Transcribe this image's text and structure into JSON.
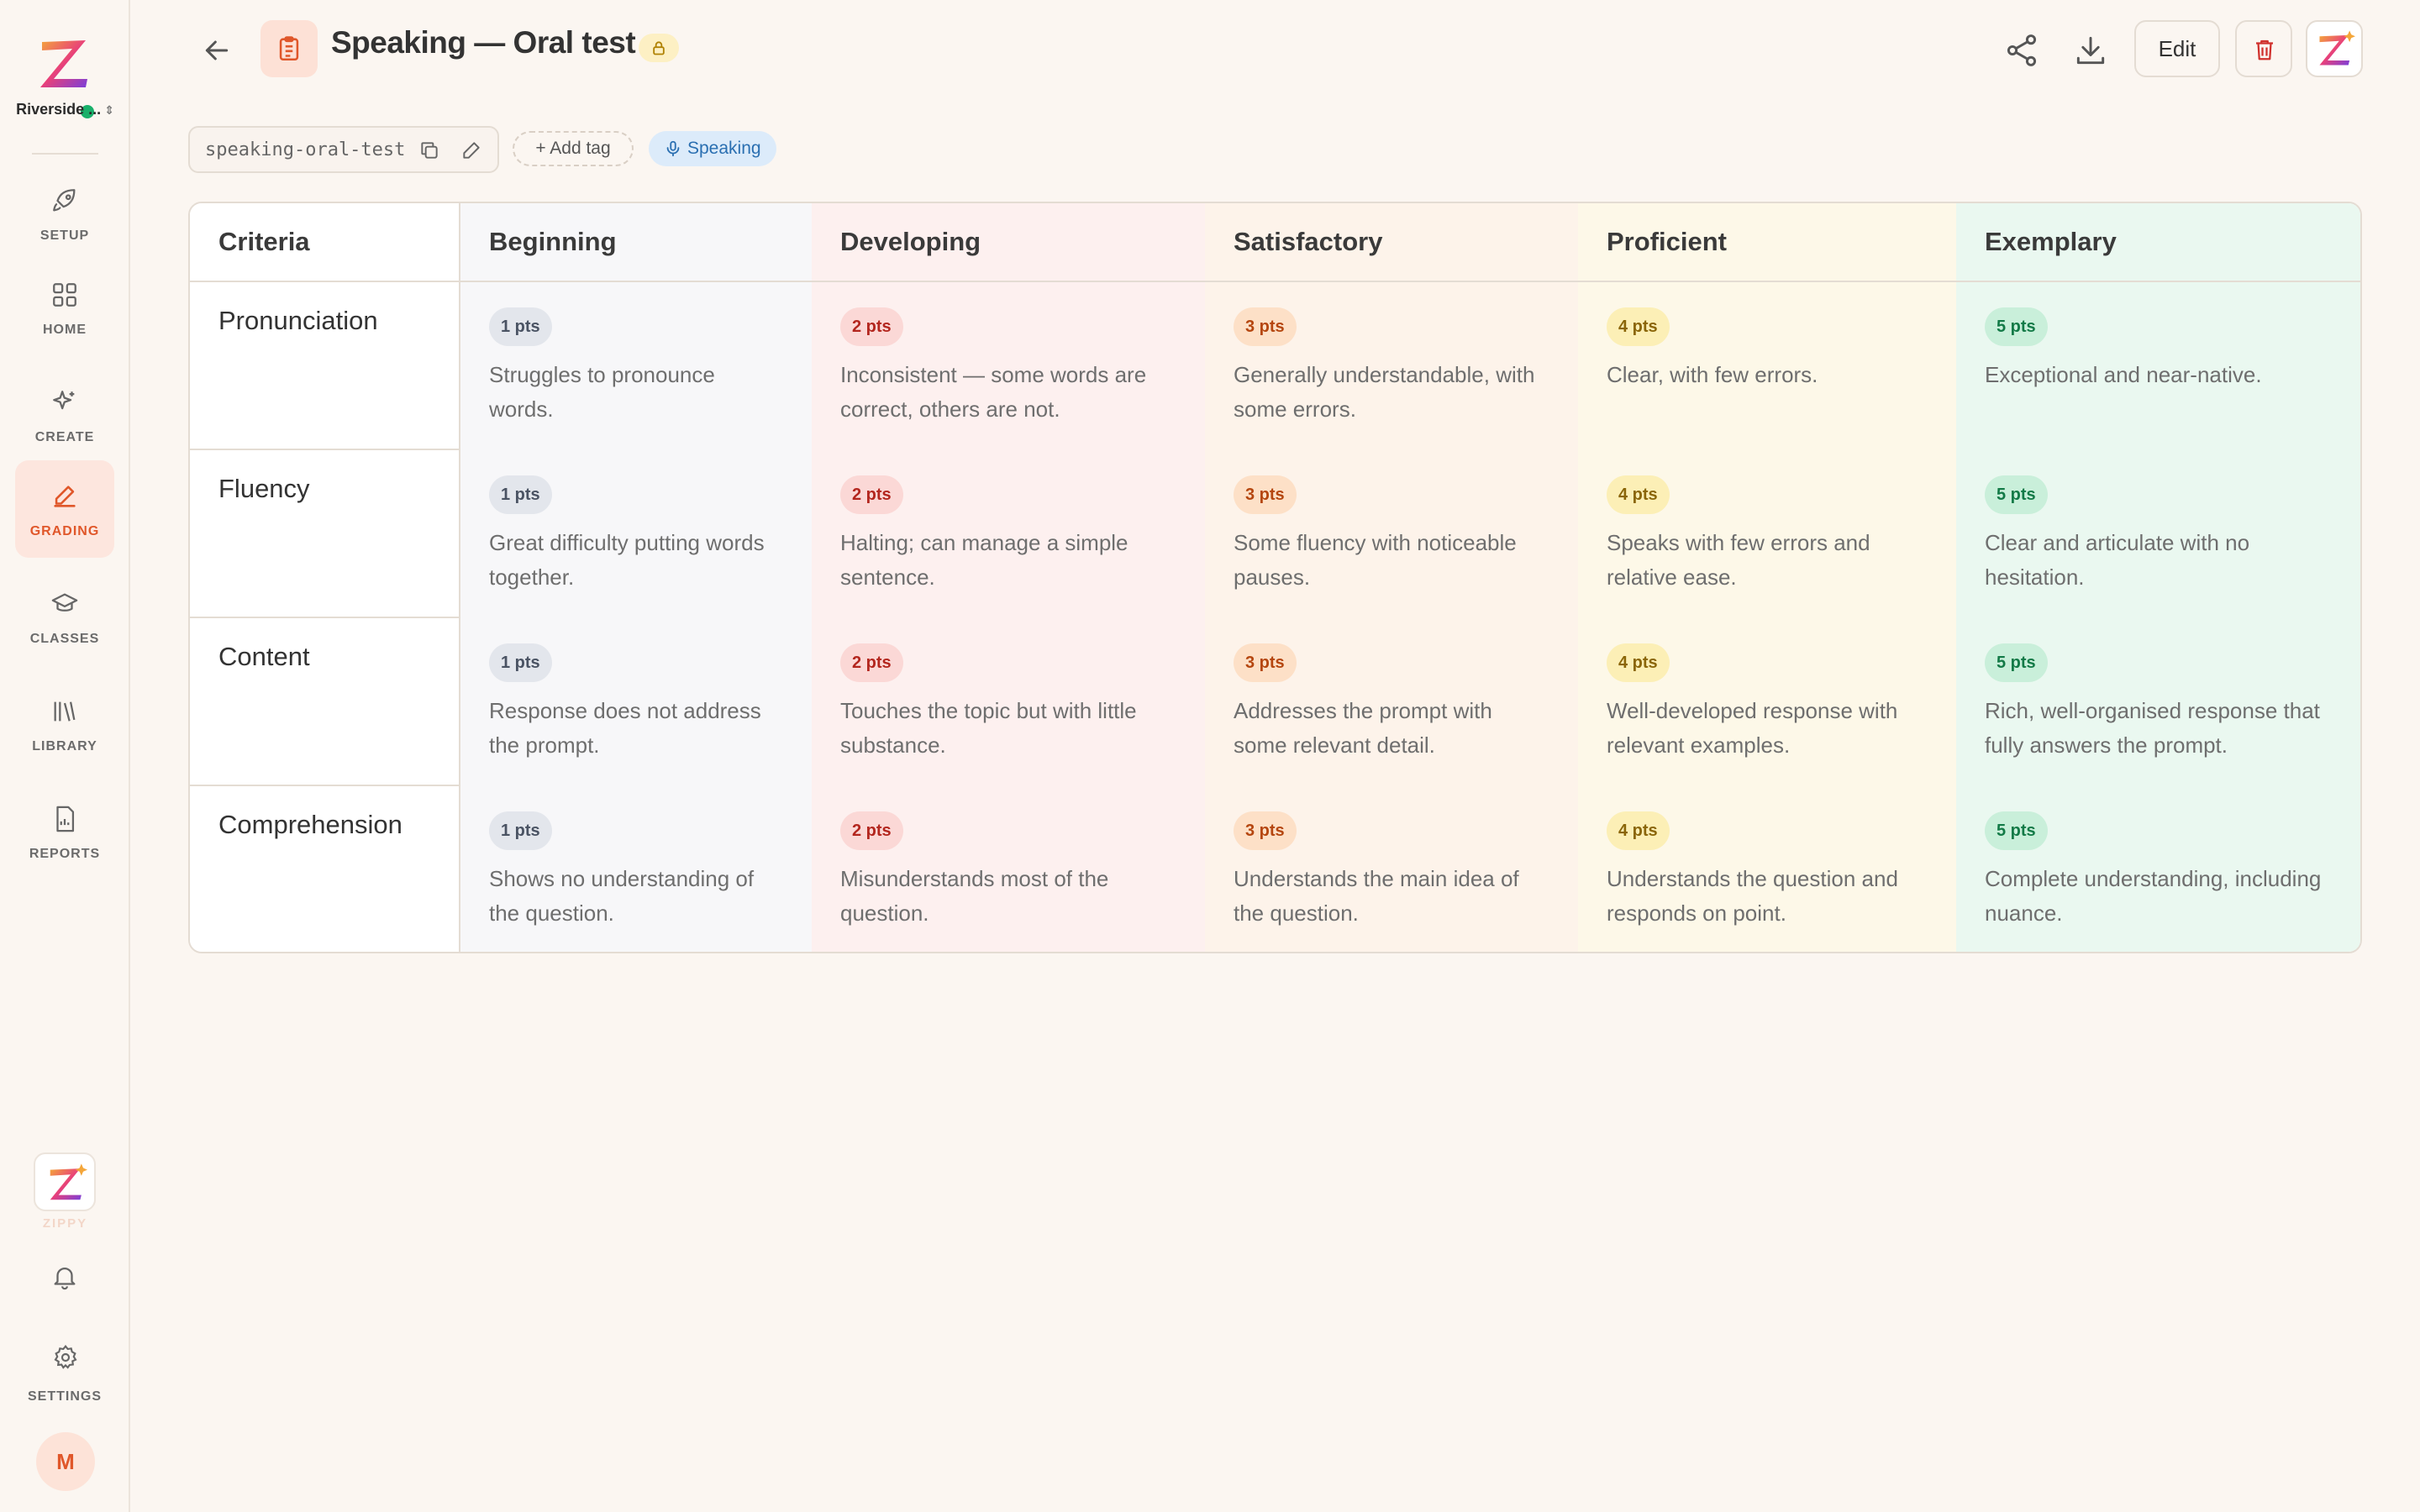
{
  "sidebar": {
    "workspace_name": "Riverside ...",
    "nav": [
      {
        "label": "SETUP",
        "icon": "rocket-icon",
        "active": false
      },
      {
        "label": "HOME",
        "icon": "grid-icon",
        "active": false
      },
      {
        "label": "CREATE",
        "icon": "sparkle-icon",
        "active": false
      },
      {
        "label": "GRADING",
        "icon": "pencil-icon",
        "active": true
      },
      {
        "label": "CLASSES",
        "icon": "graduation-cap-icon",
        "active": false
      },
      {
        "label": "LIBRARY",
        "icon": "library-icon",
        "active": false
      },
      {
        "label": "REPORTS",
        "icon": "report-icon",
        "active": false
      }
    ],
    "zippy_label": "ZIPPY",
    "settings_label": "SETTINGS",
    "avatar_initial": "M",
    "accent_color": "#e0572a"
  },
  "header": {
    "title": "Speaking — Oral test",
    "edit_label": "Edit"
  },
  "tags": {
    "slug": "speaking-oral-test",
    "add_tag_label": "+ Add tag",
    "category_tag": "Speaking"
  },
  "rubric": {
    "criteria_header": "Criteria",
    "levels": [
      {
        "name": "Beginning",
        "points": "1 pts",
        "bg": "#f7f7f9",
        "pill_bg": "#e3e6ec",
        "pill_fg": "#4a5363"
      },
      {
        "name": "Developing",
        "points": "2 pts",
        "bg": "#fdf0ef",
        "pill_bg": "#fbd8d6",
        "pill_fg": "#b3261e"
      },
      {
        "name": "Satisfactory",
        "points": "3 pts",
        "bg": "#fdf3ea",
        "pill_bg": "#fde0c7",
        "pill_fg": "#b5460f"
      },
      {
        "name": "Proficient",
        "points": "4 pts",
        "bg": "#fdf8e8",
        "pill_bg": "#fcefb6",
        "pill_fg": "#8a6508"
      },
      {
        "name": "Exemplary",
        "points": "5 pts",
        "bg": "#eaf8f0",
        "pill_bg": "#c9efda",
        "pill_fg": "#137a47"
      }
    ],
    "criteria": [
      {
        "name": "Pronunciation",
        "descriptions": [
          "Struggles to pronounce words.",
          "Inconsistent — some words are correct, others are not.",
          "Generally understandable, with some errors.",
          "Clear, with few errors.",
          "Exceptional and near-native."
        ]
      },
      {
        "name": "Fluency",
        "descriptions": [
          "Great difficulty putting words together.",
          "Halting; can manage a simple sentence.",
          "Some fluency with noticeable pauses.",
          "Speaks with few errors and relative ease.",
          "Clear and articulate with no hesitation."
        ]
      },
      {
        "name": "Content",
        "descriptions": [
          "Response does not address the prompt.",
          "Touches the topic but with little substance.",
          "Addresses the prompt with some relevant detail.",
          "Well-developed response with relevant examples.",
          "Rich, well-organised response that fully answers the prompt."
        ]
      },
      {
        "name": "Comprehension",
        "descriptions": [
          "Shows no understanding of the question.",
          "Misunderstands most of the question.",
          "Understands the main idea of the question.",
          "Understands the question and responds on point.",
          "Complete understanding, including nuance."
        ]
      }
    ]
  }
}
